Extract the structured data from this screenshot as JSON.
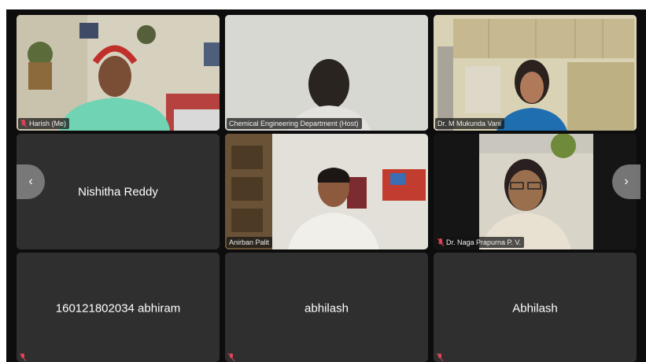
{
  "participants": [
    {
      "name": "Harish (Me)",
      "video": true,
      "muted": true
    },
    {
      "name": "Chemical Engineering Department (Host)",
      "video": true,
      "muted": false
    },
    {
      "name": "Dr. M Mukunda Vani",
      "video": true,
      "muted": false,
      "active_speaker": true
    },
    {
      "name": "Nishitha Reddy",
      "video": false,
      "muted": false
    },
    {
      "name": "Anirban Palit",
      "video": true,
      "muted": false
    },
    {
      "name": "Dr. Naga Prapurna P. V.",
      "video": true,
      "muted": true
    },
    {
      "name": "160121802034 abhiram",
      "video": false,
      "muted": true
    },
    {
      "name": "abhilash",
      "video": false,
      "muted": true
    },
    {
      "name": "Abhilash",
      "video": false,
      "muted": true
    }
  ],
  "nav": {
    "prev": "‹",
    "next": "›"
  },
  "colors": {
    "tile_bg": "#2f2f2f",
    "stage_bg": "#0d0d0d",
    "active_border": "#6aa6e6",
    "mic_off": "#e0445a"
  },
  "icons": {
    "muted": "mic-off-icon",
    "prev": "chevron-left-icon",
    "next": "chevron-right-icon"
  }
}
